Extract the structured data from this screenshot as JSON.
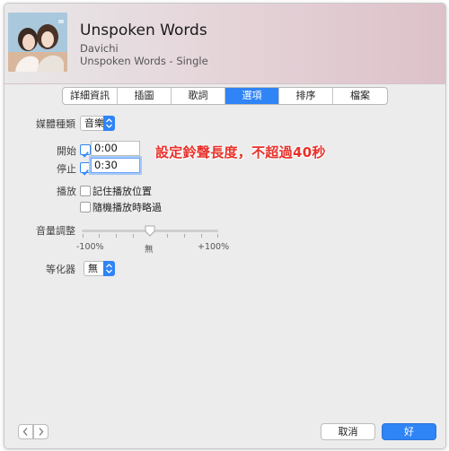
{
  "header": {
    "title": "Unspoken Words",
    "artist": "Davichi",
    "album": "Unspoken Words - Single"
  },
  "tabs": [
    {
      "label": "詳細資訊",
      "active": false
    },
    {
      "label": "插圖",
      "active": false
    },
    {
      "label": "歌詞",
      "active": false
    },
    {
      "label": "選項",
      "active": true
    },
    {
      "label": "排序",
      "active": false
    },
    {
      "label": "檔案",
      "active": false
    }
  ],
  "options": {
    "media_kind_label": "媒體種類",
    "media_kind_value": "音樂",
    "start_label": "開始",
    "start_value": "0:00",
    "start_checked": true,
    "stop_label": "停止",
    "stop_value": "0:30",
    "stop_checked": true,
    "playback_label": "播放",
    "remember_position_label": "記住播放位置",
    "remember_position_checked": false,
    "skip_shuffle_label": "隨機播放時略過",
    "skip_shuffle_checked": false,
    "volume_label": "音量調整",
    "volume_min": "-100%",
    "volume_mid": "無",
    "volume_max": "+100%",
    "volume_value_percent": 0,
    "eq_label": "等化器",
    "eq_value": "無"
  },
  "annotation": {
    "text": "設定鈴聲長度，不超過40秒"
  },
  "footer": {
    "prev_glyph": "〈",
    "next_glyph": "〉",
    "cancel_label": "取消",
    "ok_label": "好"
  },
  "colors": {
    "accent": "#2f84f6",
    "annotation": "#e8312a"
  }
}
